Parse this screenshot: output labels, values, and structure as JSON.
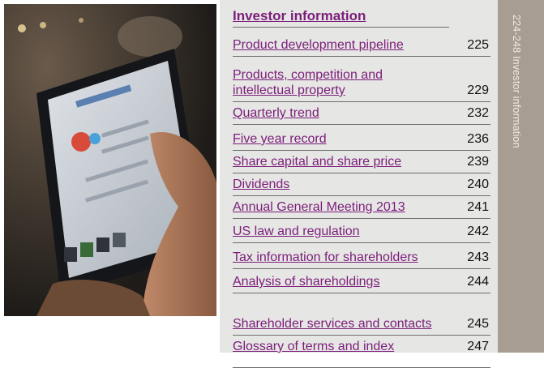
{
  "section_tab": "224-248 Investor information",
  "toc": {
    "title": "Investor information",
    "entries": [
      {
        "label": "Product development pipeline",
        "page": "225"
      },
      {
        "label": "Products, competition and intellectual property",
        "page": "229"
      },
      {
        "label": "Quarterly trend",
        "page": "232"
      },
      {
        "label": "Five year record",
        "page": "236"
      },
      {
        "label": "Share capital and share price",
        "page": "239"
      },
      {
        "label": "Dividends",
        "page": "240"
      },
      {
        "label": "Annual General Meeting 2013",
        "page": "241"
      },
      {
        "label": "US law and regulation",
        "page": "242"
      },
      {
        "label": "Tax information for shareholders",
        "page": "243"
      },
      {
        "label": "Analysis of shareholdings",
        "page": "244"
      },
      {
        "label": "Shareholder services and contacts",
        "page": "245"
      },
      {
        "label": "Glossary of terms and index",
        "page": "247"
      }
    ]
  },
  "colors": {
    "link": "#7b1e7a",
    "panel": "#e6e6e4",
    "band": "#a79d92"
  }
}
